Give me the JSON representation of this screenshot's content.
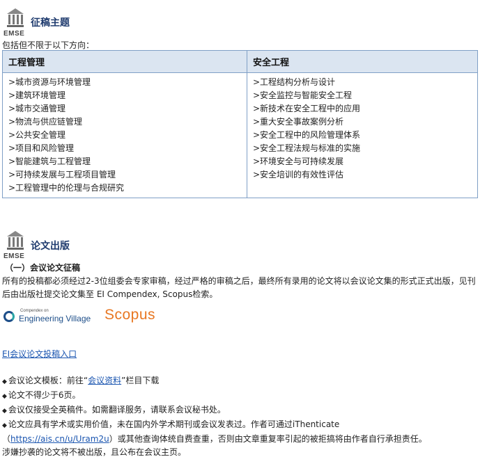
{
  "section1": {
    "logo_text": "EMSE",
    "title": "征稿主题",
    "intro": "包括但不限于以下方向：",
    "table": {
      "col1_header": "工程管理",
      "col2_header": "安全工程",
      "col1_items": [
        ">城市资源与环境管理",
        ">建筑环境管理",
        ">城市交通管理",
        ">物流与供应链管理",
        ">公共安全管理",
        ">项目和风险管理",
        ">智能建筑与工程管理",
        ">可持续发展与工程项目管理",
        ">工程管理中的伦理与合规研究"
      ],
      "col2_items": [
        ">工程结构分析与设计",
        ">安全监控与智能安全工程",
        ">新技术在安全工程中的应用",
        ">重大安全事故案例分析",
        ">安全工程中的风险管理体系",
        ">安全工程法规与标准的实施",
        ">环境安全与可持续发展",
        ">安全培训的有效性评估"
      ]
    }
  },
  "section2": {
    "logo_text": "EMSE",
    "title": "论文出版",
    "subhead": "（一）会议论文征稿",
    "paragraph": "所有的投稿都必须经过2-3位组委会专家审稿，经过严格的审稿之后，最终所有录用的论文将以会议论文集的形式正式出版，见刊后由出版社提交论文集至 EI Compendex, Scopus检索。",
    "ev_logo": {
      "small": "Compendex on",
      "big": "Engineering Village"
    },
    "scopus_logo": "Scopus",
    "submit_link": "EI会议论文投稿入口",
    "bullets": {
      "b1_prefix": "会议论文模板：前往“",
      "b1_link": "会议资料",
      "b1_suffix": "”栏目下载",
      "b2": "论文不得少于6页。",
      "b3": "会议仅接受全英稿件。如需翻译服务，请联系会议秘书处。",
      "b4_line1": "论文应具有学术或实用价值，未在国内外学术期刊或会议发表过。作者可通过iThenticate",
      "b4_link": "https://ais.cn/u/Uram2u",
      "b4_line2_prefix": "（",
      "b4_line2_suffix": "）或其他查询体统自费查重，否则由文章重复率引起的被拒搞将由作者自行承担责任。",
      "b4_line3": "涉嫌抄袭的论文将不被出版，且公布在会议主页。"
    }
  },
  "colors": {
    "title_blue": "#1f3b6e",
    "table_header_bg": "#dbe5f1",
    "table_border": "#7f9fc6",
    "link": "#1a55b0",
    "scopus_orange": "#e87722"
  }
}
